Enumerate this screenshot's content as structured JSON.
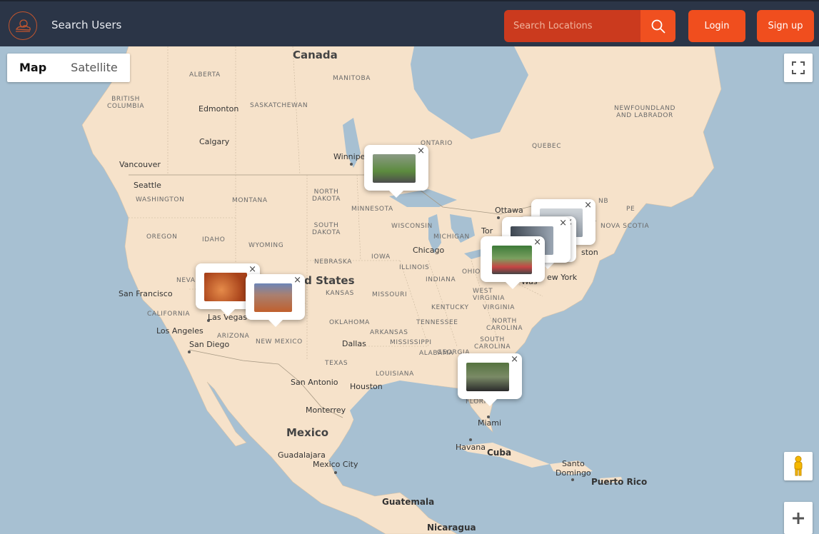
{
  "header": {
    "search_users_label": "Search Users",
    "search_placeholder": "Search Locations",
    "login_label": "Login",
    "signup_label": "Sign up"
  },
  "map": {
    "type_buttons": {
      "map": "Map",
      "satellite": "Satellite"
    },
    "countries": {
      "canada": "Canada",
      "us": "ed States",
      "mexico": "Mexico",
      "cuba": "Cuba",
      "guatemala": "Guatemala",
      "nicaragua": "Nicaragua",
      "puerto_rico": "Puerto Rico",
      "santo_domingo": "Santo\nDomingo"
    },
    "regions": {
      "alberta": "ALBERTA",
      "manitoba": "MANITOBA",
      "british_columbia": "BRITISH\nCOLUMBIA",
      "saskatchewan": "SASKATCHEWAN",
      "ontario": "ONTARIO",
      "quebec": "QUEBEC",
      "newfoundland": "NEWFOUNDLAND\nAND LABRADOR",
      "nb": "NB",
      "pe": "PE",
      "nova_scotia": "NOVA SCOTIA",
      "washington": "WASHINGTON",
      "montana": "MONTANA",
      "north_dakota": "NORTH\nDAKOTA",
      "minnesota": "MINNESOTA",
      "oregon": "OREGON",
      "idaho": "IDAHO",
      "south_dakota": "SOUTH\nDAKOTA",
      "wisconsin": "WISCONSIN",
      "michigan": "MICHIGAN",
      "wyoming": "WYOMING",
      "iowa": "IOWA",
      "nebraska": "NEBRASKA",
      "illinois": "ILLINOIS",
      "indiana": "INDIANA",
      "ohio": "OHIO",
      "nevada": "NEVA",
      "kansas": "KANSAS",
      "missouri": "MISSOURI",
      "west_virginia": "WEST\nVIRGINIA",
      "virginia": "VIRGINIA",
      "kentucky": "KENTUCKY",
      "california": "CALIFORNIA",
      "arizona": "ARIZONA",
      "oklahoma": "OKLAHOMA",
      "tennessee": "TENNESSEE",
      "north_carolina": "NORTH\nCAROLINA",
      "new_mexico": "NEW MEXICO",
      "arkansas": "ARKANSAS",
      "south_carolina": "SOUTH\nCAROLINA",
      "mississippi": "MISSISSIPPI",
      "alabama": "ALABAMA",
      "georgia": "GEORGIA",
      "texas": "TEXAS",
      "louisiana": "LOUISIANA",
      "florida": "FLORI"
    },
    "cities": {
      "edmonton": "Edmonton",
      "calgary": "Calgary",
      "vancouver": "Vancouver",
      "seattle": "Seattle",
      "winnipeg": "Winnipe",
      "ottawa": "Ottawa",
      "toronto": "Tor",
      "boston": "ston",
      "new_york": "ew York",
      "washington_dc": "Was",
      "chicago": "Chicago",
      "san_francisco": "San Francisco",
      "las_vegas": "Las Vegas",
      "los_angeles": "Los Angeles",
      "san_diego": "San Diego",
      "dallas": "Dallas",
      "san_antonio": "San Antonio",
      "houston": "Houston",
      "monterrey": "Monterrey",
      "miami": "Miami",
      "havana": "Havana",
      "guadalajara": "Guadalajara",
      "mexico_city": "Mexico City"
    },
    "popups": [
      {
        "name": "popup-minnesota",
        "close": "×",
        "colors": [
          "#5c8b3e",
          "#8a9a84"
        ]
      },
      {
        "name": "popup-northeast-a",
        "close": "×",
        "colors": [
          "#8f99a4",
          "#cfd4d9"
        ]
      },
      {
        "name": "popup-northeast-b",
        "close": "×",
        "colors": [
          "#51606f",
          "#a7b3bf"
        ]
      },
      {
        "name": "popup-northeast-c",
        "close": "×",
        "colors": [
          "#3e4752",
          "#9ba6b3"
        ]
      },
      {
        "name": "popup-washington",
        "close": "×",
        "colors": [
          "#3d7a39",
          "#c64444"
        ]
      },
      {
        "name": "popup-arizona-canyon",
        "close": "×",
        "colors": [
          "#a8421a",
          "#e58b4a"
        ]
      },
      {
        "name": "popup-utah-canyon",
        "close": "×",
        "colors": [
          "#6d86b8",
          "#c0602d"
        ]
      },
      {
        "name": "popup-florida",
        "close": "×",
        "colors": [
          "#55733f",
          "#2a2a2a"
        ]
      }
    ]
  },
  "colors": {
    "header_bg": "#2b3547",
    "accent": "#f04e1e",
    "search_bg": "#cb3a1e",
    "land": "#f6e2ca",
    "water": "#a7c0d2"
  }
}
